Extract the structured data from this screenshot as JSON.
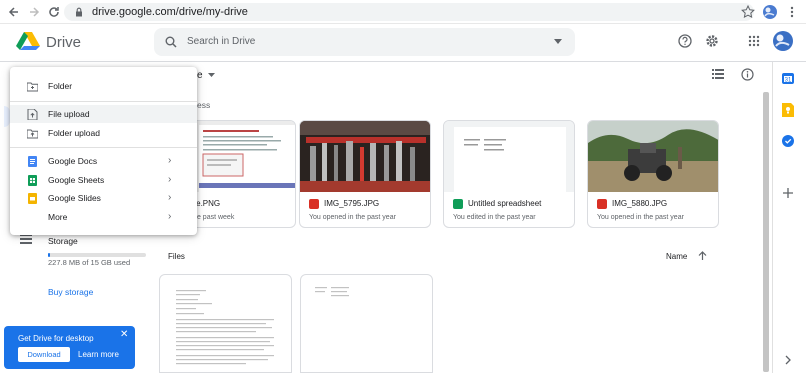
{
  "browser": {
    "url": "drive.google.com/drive/my-drive"
  },
  "drive": {
    "title": "Drive",
    "search_placeholder": "Search in Drive",
    "breadcrumb": "e"
  },
  "menu": {
    "items": [
      {
        "label": "Folder"
      },
      {
        "label": "File upload"
      },
      {
        "label": "Folder upload"
      },
      {
        "label": "Google Docs"
      },
      {
        "label": "Google Sheets"
      },
      {
        "label": "Google Slides"
      },
      {
        "label": "More"
      }
    ]
  },
  "leftnav": {
    "storage_label": "Storage",
    "storage_used": "227.8 MB of 15 GB used",
    "storage_fraction": 0.015,
    "buy_storage": "Buy storage"
  },
  "suggested": {
    "heading": "ess",
    "cards": [
      {
        "title": "ure.PNG",
        "subtitle": "ed in the past week"
      },
      {
        "title": "IMG_5795.JPG",
        "subtitle": "You opened in the past year"
      },
      {
        "title": "Untitled spreadsheet",
        "subtitle": "You edited in the past year"
      },
      {
        "title": "IMG_5880.JPG",
        "subtitle": "You opened in the past year"
      }
    ]
  },
  "files": {
    "heading": "Files",
    "sort_label": "Name"
  },
  "banner": {
    "title": "Get Drive for desktop",
    "download": "Download",
    "learn_more": "Learn more"
  },
  "colors": {
    "accent": "#1a73e8",
    "sheets": "#0f9d58",
    "docs": "#4285f4",
    "slides": "#f4b400",
    "image": "#d93025"
  }
}
